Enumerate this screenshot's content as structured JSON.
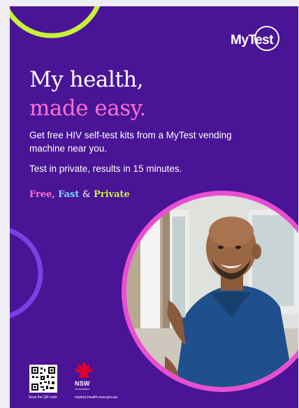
{
  "brand": {
    "name": "MyTest"
  },
  "headline": {
    "line1": "My health,",
    "line2": "made easy."
  },
  "body": {
    "paragraph1": "Get free HIV self-test kits from a MyTest vending machine near you.",
    "paragraph2": "Test in private, results in 15 minutes."
  },
  "tagline": {
    "free": "Free",
    "comma": ",",
    "fast": "Fast",
    "amp": "&",
    "private": "Private"
  },
  "footer": {
    "qr_label": "Scan the QR code",
    "nsw_logo_text": "NSW",
    "nsw_sub": "GOVERNMENT",
    "url": "mytest.health.nsw.gov.au"
  },
  "colors": {
    "background": "#4a1496",
    "pink": "#ff6fd0",
    "blue": "#7fd3ff",
    "lime": "#c8f03a",
    "ring_pink": "#e84fd0",
    "ring_violet": "#7b3fe4"
  },
  "icons": [
    "brand-logo",
    "qr-code",
    "nsw-waratah-icon"
  ]
}
